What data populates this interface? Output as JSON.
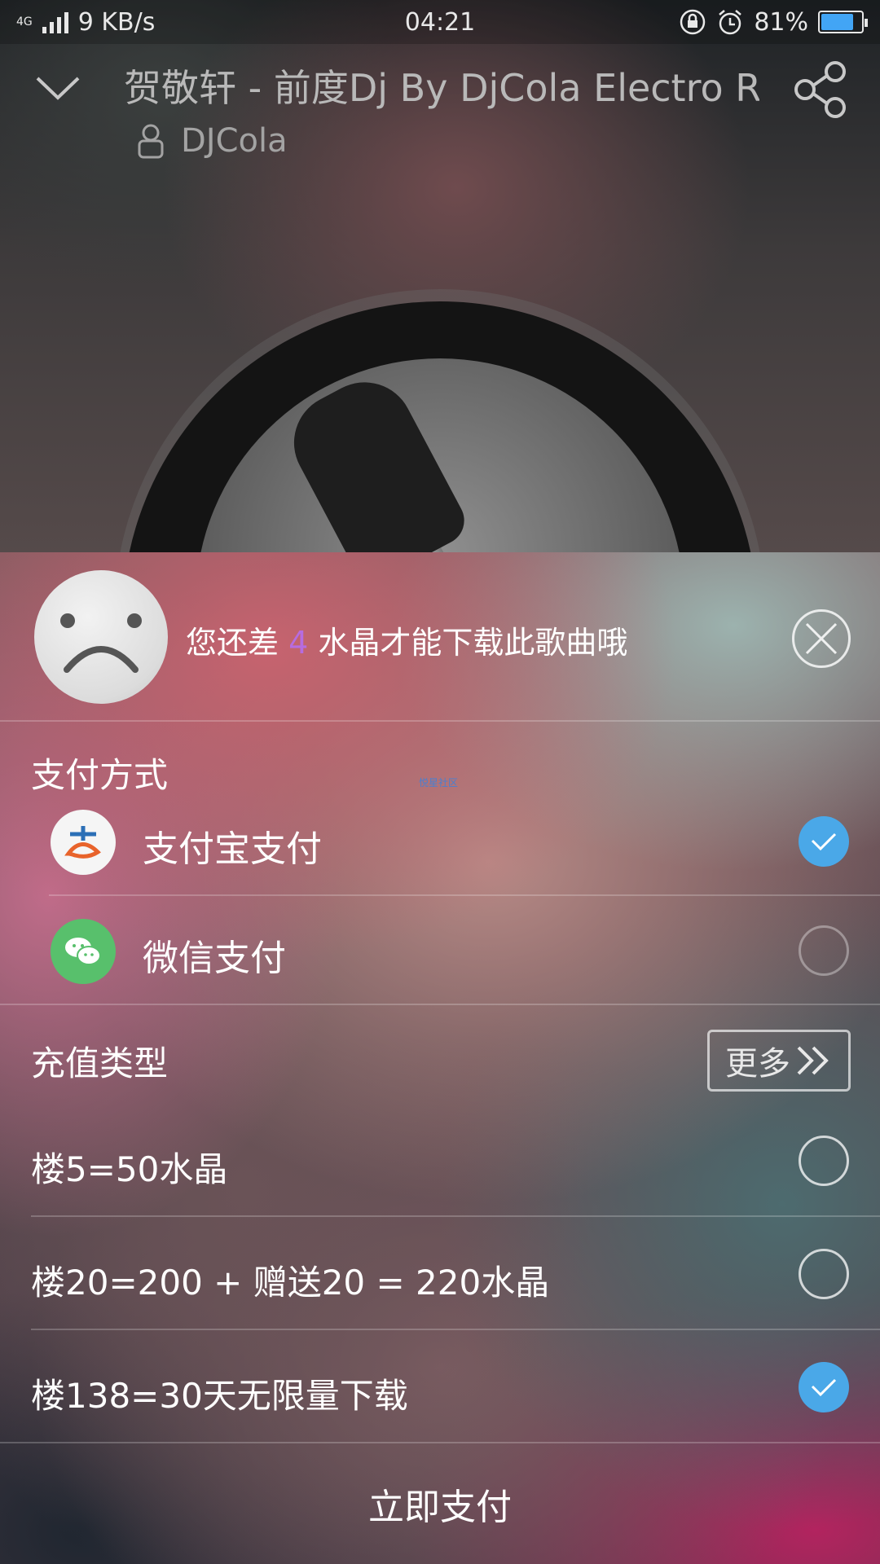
{
  "status_bar": {
    "network": "4G",
    "speed": "9 KB/s",
    "time": "04:21",
    "battery": "81%",
    "battery_level": 0.81
  },
  "player": {
    "song_title": "贺敬轩 - 前度Dj By DjCola Electro R..",
    "artist": "DJCola"
  },
  "sheet": {
    "warning_prefix": "您还差 ",
    "warning_count": "4",
    "warning_suffix": " 水晶才能下载此歌曲哦",
    "watermark": "悦星社区",
    "payment": {
      "title": "支付方式",
      "options": [
        {
          "label": "支付宝支付",
          "icon": "alipay-icon",
          "selected": true
        },
        {
          "label": "微信支付",
          "icon": "wechat-icon",
          "selected": false
        }
      ]
    },
    "recharge": {
      "title": "充值类型",
      "more_label": "更多",
      "options": [
        {
          "label": "楼5=50水晶",
          "selected": false
        },
        {
          "label": "楼20=200 + 赠送20 = 220水晶",
          "selected": false
        },
        {
          "label": "楼138=30天无限量下载",
          "selected": true
        }
      ]
    },
    "pay_now_label": "立即支付"
  },
  "colors": {
    "accent_blue": "#4aa8e8",
    "warning_number": "#b66ce0",
    "wechat_green": "#58c06c"
  }
}
